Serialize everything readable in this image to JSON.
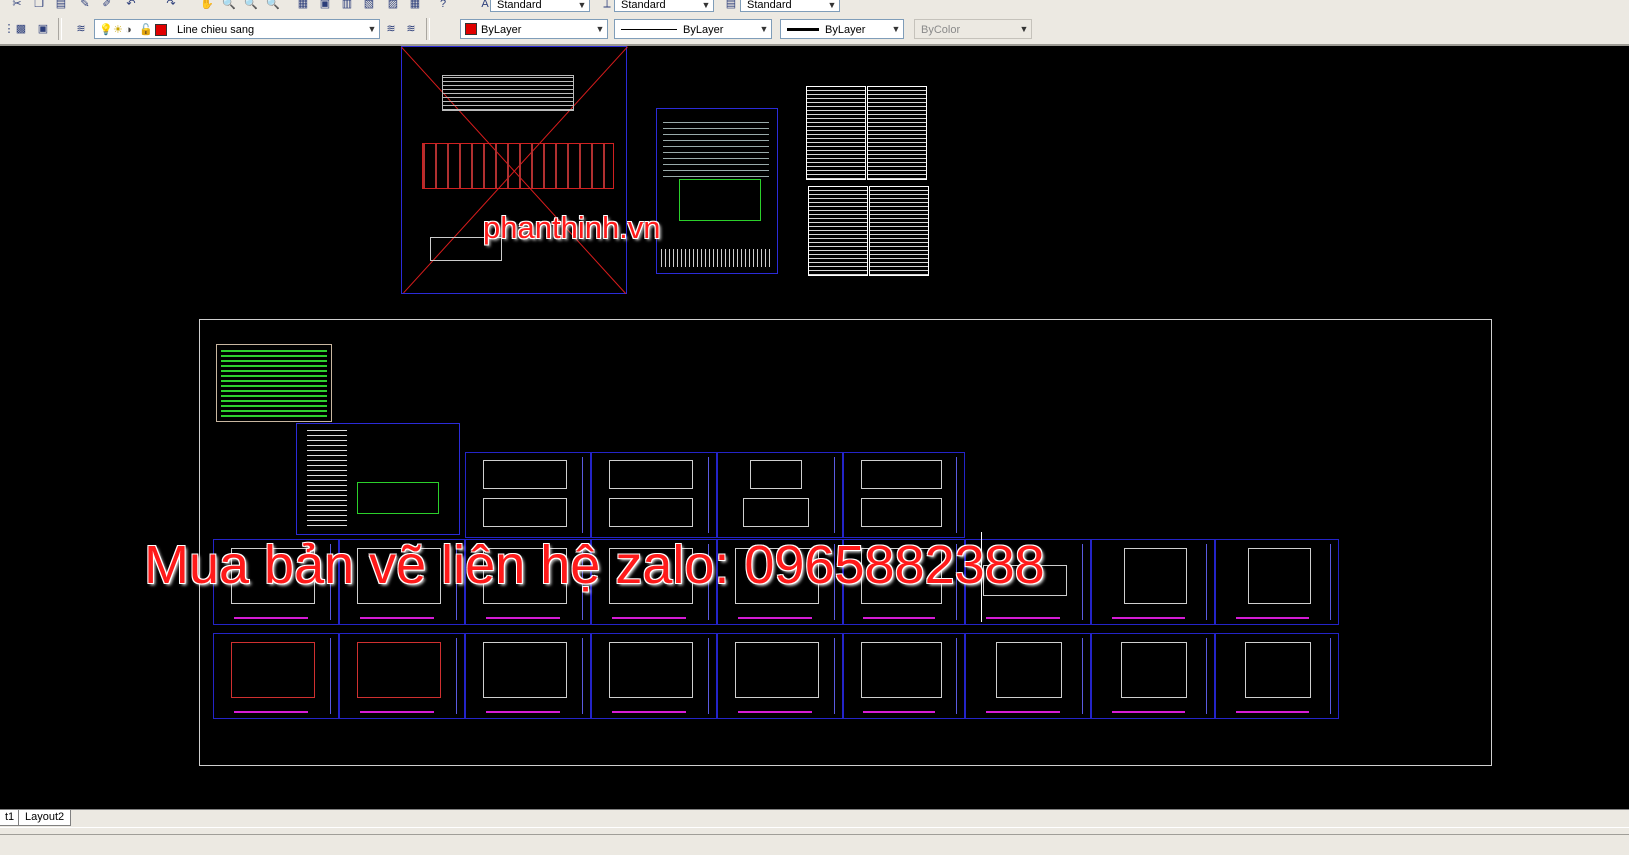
{
  "toolbar_top": {
    "text_style": "Standard",
    "dim_style": "Standard",
    "table_style": "Standard"
  },
  "toolbar_layers": {
    "layer_name": "Line chieu sang",
    "layer_color": "#e00000",
    "color": "ByLayer",
    "color_swatch": "#e00000",
    "linetype": "ByLayer",
    "lineweight": "ByLayer",
    "plotstyle": "ByColor"
  },
  "watermarks": {
    "site": "phanthinh.vn",
    "contact": "Mua bản vẽ liên hệ zalo: 0965882388"
  },
  "layout_tabs": [
    "t1",
    "Layout2"
  ],
  "colors": {
    "canvas": "#000000",
    "sheet_border": "#2424c8",
    "watermark": "#ff1a1a",
    "title_bar": "#d51cd5"
  }
}
